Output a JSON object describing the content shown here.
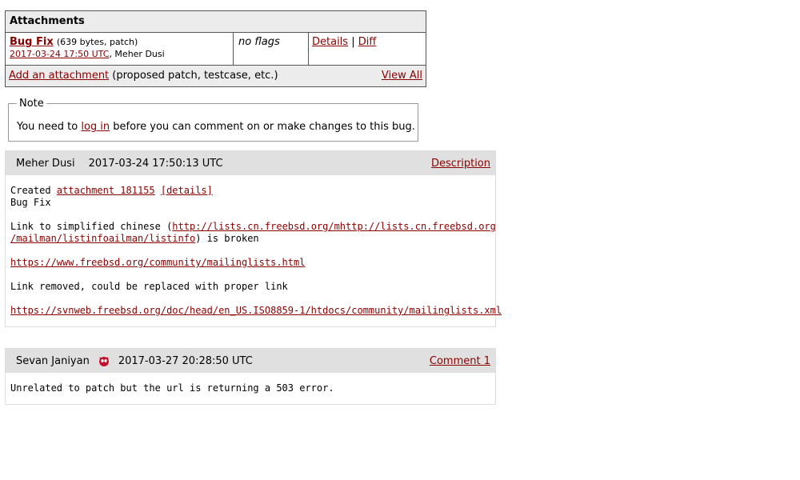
{
  "attachments": {
    "header": "Attachments",
    "item": {
      "title": "Bug Fix",
      "meta": "(639 bytes, patch)",
      "date": "2017-03-24 17:50 UTC",
      "author": ", Meher Dusi",
      "flags": "no flags",
      "details": "Details",
      "sep": "|",
      "diff": "Diff"
    },
    "footer": {
      "add": "Add an attachment",
      "hint": " (proposed patch, testcase, etc.)",
      "view_all": "View All"
    }
  },
  "note": {
    "legend": "Note",
    "prefix": "You need to ",
    "login": "log in",
    "suffix": " before you can comment on or make changes to this bug."
  },
  "comments": [
    {
      "author": "Meher Dusi",
      "time": "2017-03-24 17:50:13 UTC",
      "link": "Description",
      "created": "Created ",
      "attach_link": "attachment 181155",
      "details_link": "[details]",
      "line2": "Bug Fix",
      "line3_pre": "Link to simplified chinese (",
      "url1a": "http://lists.cn.freebsd.org/mhttp://lists.cn.freebsd.org",
      "url1b": "/mailman/listinfoailman/listinfo",
      "line3_post": ") is broken",
      "url2": "https://www.freebsd.org/community/mailinglists.html",
      "line5": "Link removed, could be replaced with proper link",
      "url3": "https://svnweb.freebsd.org/doc/head/en_US.ISO8859-1/htdocs/community/mailinglists.xml"
    },
    {
      "author": "Sevan Janiyan",
      "time": "2017-03-27 20:28:50 UTC",
      "link": "Comment 1",
      "text": "Unrelated to patch but the url is returning a 503 error."
    }
  ],
  "colors": {
    "link": "#8b0000",
    "header_bg": "#e0e0e0"
  }
}
